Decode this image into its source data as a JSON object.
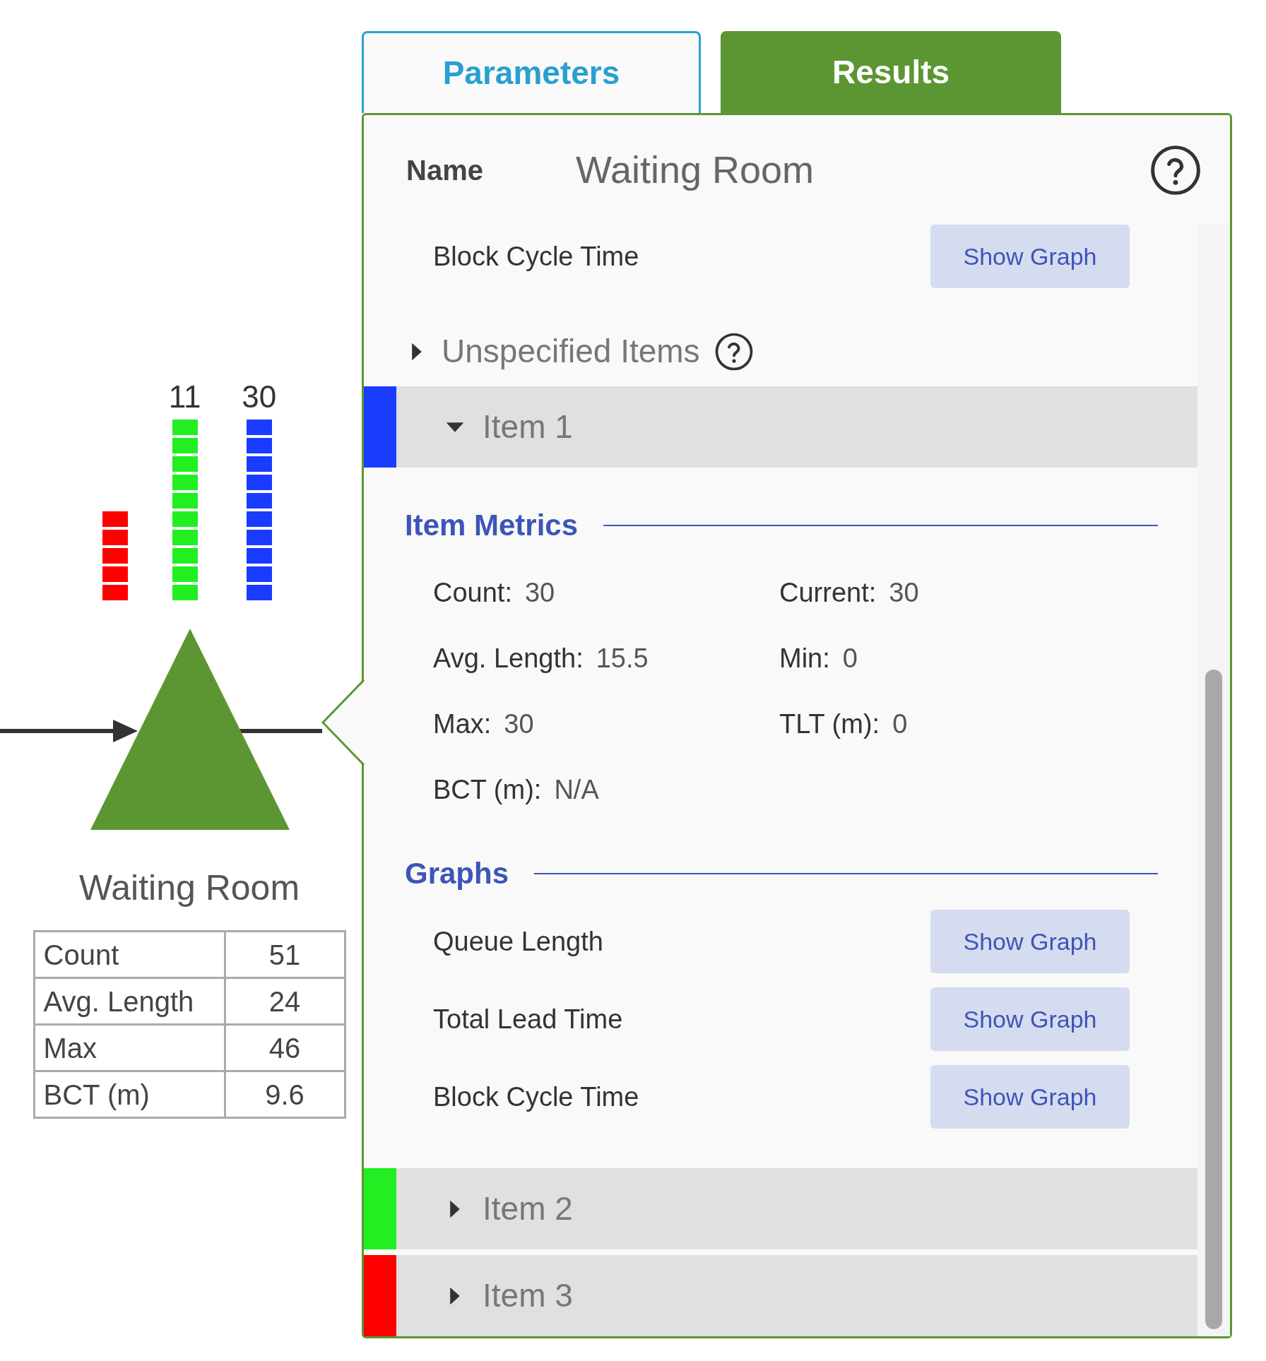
{
  "tabs": [
    {
      "label": "Parameters",
      "selected": false
    },
    {
      "label": "Results",
      "selected": true
    }
  ],
  "canvas": {
    "queue_counts": [
      {
        "color": "#ff0000"
      },
      {
        "label": "11",
        "color": "#22ee22"
      },
      {
        "label": "30",
        "color": "#1a3cff"
      }
    ],
    "node_label": "Waiting Room",
    "stats": [
      {
        "label": "Count",
        "value": "51"
      },
      {
        "label": "Avg. Length",
        "value": "24"
      },
      {
        "label": "Max",
        "value": "46"
      },
      {
        "label": "BCT (m)",
        "value": "9.6"
      }
    ]
  },
  "panel": {
    "name_label": "Name",
    "name_value": "Waiting Room",
    "top_row": {
      "label": "Block Cycle Time",
      "button": "Show Graph"
    },
    "unspecified": {
      "label": "Unspecified Items",
      "expanded": false
    },
    "items": [
      {
        "label": "Item 1",
        "color": "#1a3cff",
        "expanded": true,
        "metrics_title": "Item Metrics",
        "metrics": [
          {
            "label": "Count:",
            "value": "30"
          },
          {
            "label": "Current:",
            "value": "30"
          },
          {
            "label": "Avg. Length:",
            "value": "15.5"
          },
          {
            "label": "Min:",
            "value": "0"
          },
          {
            "label": "Max:",
            "value": "30"
          },
          {
            "label": "TLT (m):",
            "value": "0"
          },
          {
            "label": "BCT (m):",
            "value": "N/A"
          }
        ],
        "graphs_title": "Graphs",
        "graphs": [
          {
            "label": "Queue Length",
            "button": "Show Graph"
          },
          {
            "label": "Total Lead Time",
            "button": "Show Graph"
          },
          {
            "label": "Block Cycle Time",
            "button": "Show Graph"
          }
        ]
      },
      {
        "label": "Item 2",
        "color": "#22ee22",
        "expanded": false
      },
      {
        "label": "Item 3",
        "color": "#ff0000",
        "expanded": false
      }
    ]
  }
}
